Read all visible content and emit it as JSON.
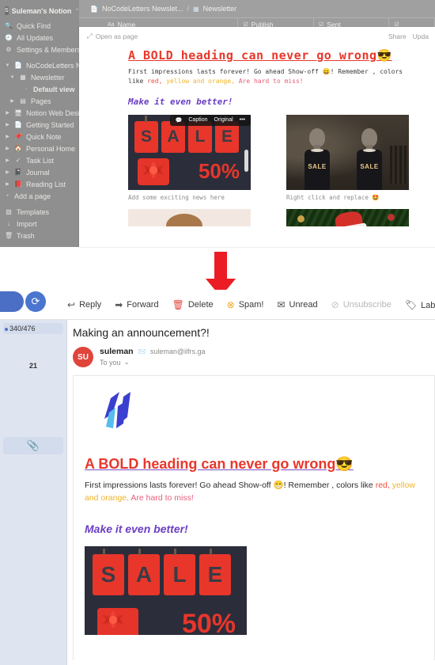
{
  "notion": {
    "workspace": {
      "avatar_letter": "S",
      "name": "Suleman's Notion",
      "caret": "⌃⌄"
    },
    "nav_top": [
      {
        "icon": "🔍",
        "label": "Quick Find"
      },
      {
        "icon": "🕘",
        "label": "All Updates"
      },
      {
        "icon": "⚙",
        "label": "Settings & Members"
      }
    ],
    "pages": [
      {
        "label": "NoCodeLetters News",
        "twisty": "▼",
        "icon": "📄",
        "level": 0,
        "bold": false
      },
      {
        "label": "Newsletter",
        "twisty": "▼",
        "icon": "▦",
        "level": 1,
        "bold": false
      },
      {
        "label": "Default view",
        "twisty": "·",
        "icon": "",
        "level": 2,
        "bold": true
      },
      {
        "label": "Pages",
        "twisty": "▶",
        "icon": "▤",
        "level": 1,
        "bold": false
      },
      {
        "label": "Notion Web Designe",
        "twisty": "▶",
        "icon": "🖥",
        "level": 0,
        "bold": false
      },
      {
        "label": "Getting Started",
        "twisty": "▶",
        "icon": "📄",
        "level": 0,
        "bold": false
      },
      {
        "label": "Quick Note",
        "twisty": "▶",
        "icon": "📌",
        "level": 0,
        "bold": false
      },
      {
        "label": "Personal Home",
        "twisty": "▶",
        "icon": "🏠",
        "level": 0,
        "bold": false
      },
      {
        "label": "Task List",
        "twisty": "▶",
        "icon": "✓",
        "level": 0,
        "bold": false
      },
      {
        "label": "Journal",
        "twisty": "▶",
        "icon": "📓",
        "level": 0,
        "bold": false
      },
      {
        "label": "Reading List",
        "twisty": "▶",
        "icon": "📕",
        "level": 0,
        "bold": false
      },
      {
        "label": "Add a page",
        "twisty": "+",
        "icon": "",
        "level": 0,
        "bold": false
      }
    ],
    "nav_bottom": [
      {
        "icon": "▧",
        "label": "Templates"
      },
      {
        "icon": "↓",
        "label": "Import"
      },
      {
        "icon": "🗑",
        "label": "Trash"
      }
    ],
    "breadcrumb": {
      "icon": "📄",
      "root": "NoCodeLetters Newslet...",
      "sep": "/",
      "db_icon": "▦",
      "leaf": "Newsletter"
    },
    "table_headers": [
      {
        "glyph": "Aa",
        "label": "Name"
      },
      {
        "glyph": "☑",
        "label": "Publish"
      },
      {
        "glyph": "☑",
        "label": "Sent"
      },
      {
        "glyph": "☑",
        "label": ""
      }
    ],
    "peek": {
      "open_as_page_icon": "⤢",
      "open_as_page": "Open as page",
      "share": "Share",
      "update": "Upda",
      "heading": "A BOLD heading can never go wrong",
      "heading_emoji": "😎",
      "para_1": "First impressions lasts forever! Go ahead Show-off ",
      "para_emoji": "😄",
      "para_2": "! Remember , colors",
      "para_3_prefix": "like ",
      "para_red": "red,",
      "para_yellow": " yellow and orange,",
      "para_pink": " Are hard to miss!",
      "subheading": "Make it even better!",
      "image_toolbar": {
        "comment_icon": "💬",
        "caption": "Caption",
        "original": "Original",
        "more": "•••"
      },
      "sale_letters": [
        "S",
        "A",
        "L",
        "E"
      ],
      "sale_percent": "50%",
      "mannequin_text": "SALE",
      "caption_left": "Add some exciting news here",
      "caption_right": "Right click and replace 🤩"
    }
  },
  "arrow": {
    "color": "#ec1c24",
    "points_to": "Spam!"
  },
  "mail": {
    "refresh_icon": "⟳",
    "actions": [
      {
        "icon": "↩",
        "label": "Reply",
        "icon_color": "#5a5a5a",
        "dim": false
      },
      {
        "icon": "➡",
        "label": "Forward",
        "icon_color": "#5a5a5a",
        "dim": false
      },
      {
        "icon": "🗑",
        "label": "Delete",
        "icon_color": "#e34a3c",
        "dim": false
      },
      {
        "icon": "⊗",
        "label": "Spam!",
        "icon_color": "#f2a81d",
        "dim": false
      },
      {
        "icon": "✉",
        "label": "Unread",
        "icon_color": "#4a4a4a",
        "dim": false
      },
      {
        "icon": "⊘",
        "label": "Unsubscribe",
        "icon_color": "#c2c2c2",
        "dim": true
      },
      {
        "icon": "🏷",
        "label": "Label ▾",
        "icon_color": "#4a4a4a",
        "dim": false
      }
    ],
    "quota": "340/476",
    "count": "21",
    "attachment_icon": "📎",
    "subject": "Making an announcement?!",
    "sender": {
      "avatar": "SU",
      "name": "suleman",
      "badge": "📨",
      "email": "suleman@ilfrs.ga",
      "to": "To you",
      "caret": "⌄"
    },
    "content": {
      "heading": "A BOLD heading can never go wrong",
      "heading_emoji": "😎",
      "para_1": "First impressions lasts forever! Go ahead Show-off ",
      "para_emoji": "😁",
      "para_2": "! Remember , colors like ",
      "para_red": "red,",
      "para_yellow": "yellow and orange,",
      "para_pink": " Are hard to miss!",
      "subheading": "Make it even better!",
      "sale_letters": [
        "S",
        "A",
        "L",
        "E"
      ],
      "sale_percent": "50%"
    }
  }
}
